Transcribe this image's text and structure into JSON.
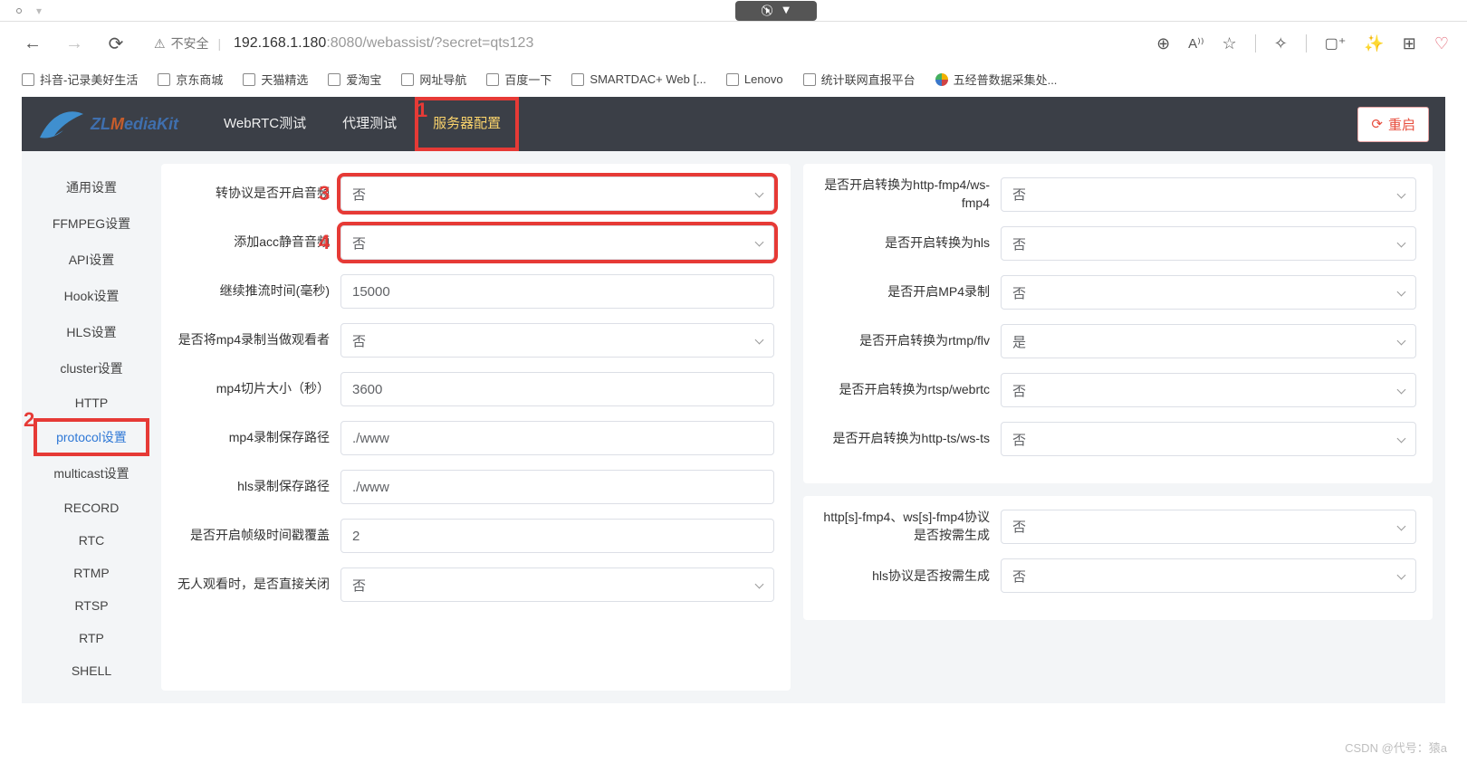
{
  "browser": {
    "url_host": "192.168.1.180",
    "url_port": ":8080",
    "url_path": "/webassist/?secret=qts123",
    "insecure_label": "不安全",
    "bookmarks": [
      "抖音-记录美好生活",
      "京东商城",
      "天猫精选",
      "爱淘宝",
      "网址导航",
      "百度一下",
      "SMARTDAC+ Web [...",
      "Lenovo",
      "统计联网直报平台",
      "五经普数据采集处..."
    ]
  },
  "logo_text": {
    "zl": "ZL",
    "m": "M",
    "rest": "ediaKit"
  },
  "nav": {
    "items": [
      "WebRTC测试",
      "代理测试",
      "服务器配置"
    ],
    "activeIndex": 2
  },
  "restart_label": "重启",
  "annotations": {
    "one": "1",
    "two": "2",
    "three": "3",
    "four": "4"
  },
  "watermark": "CSDN @代号：猿a",
  "sidebar": {
    "items": [
      "通用设置",
      "FFMPEG设置",
      "API设置",
      "Hook设置",
      "HLS设置",
      "cluster设置",
      "HTTP",
      "protocol设置",
      "multicast设置",
      "RECORD",
      "RTC",
      "RTMP",
      "RTSP",
      "RTP",
      "SHELL"
    ],
    "activeIndex": 7
  },
  "leftForm": {
    "rows": [
      {
        "label": "转协议是否开启音频",
        "value": "否",
        "type": "select",
        "highlight": true,
        "mark": "3"
      },
      {
        "label": "添加acc静音音频",
        "value": "否",
        "type": "select",
        "highlight": true,
        "mark": "4"
      },
      {
        "label": "继续推流时间(毫秒)",
        "value": "15000",
        "type": "input"
      },
      {
        "label": "是否将mp4录制当做观看者",
        "value": "否",
        "type": "select"
      },
      {
        "label": "mp4切片大小（秒）",
        "value": "3600",
        "type": "input"
      },
      {
        "label": "mp4录制保存路径",
        "value": "./www",
        "type": "input"
      },
      {
        "label": "hls录制保存路径",
        "value": "./www",
        "type": "input"
      },
      {
        "label": "是否开启帧级时间戳覆盖",
        "value": "2",
        "type": "input"
      },
      {
        "label": "无人观看时，是否直接关闭",
        "value": "否",
        "type": "select"
      }
    ]
  },
  "rightTopForm": {
    "rows": [
      {
        "label": "是否开启转换为http-fmp4/ws-fmp4",
        "value": "否"
      },
      {
        "label": "是否开启转换为hls",
        "value": "否"
      },
      {
        "label": "是否开启MP4录制",
        "value": "否"
      },
      {
        "label": "是否开启转换为rtmp/flv",
        "value": "是"
      },
      {
        "label": "是否开启转换为rtsp/webrtc",
        "value": "否"
      },
      {
        "label": "是否开启转换为http-ts/ws-ts",
        "value": "否"
      }
    ]
  },
  "rightBottomForm": {
    "rows": [
      {
        "label": "http[s]-fmp4、ws[s]-fmp4协议是否按需生成",
        "value": "否"
      },
      {
        "label": "hls协议是否按需生成",
        "value": "否"
      }
    ]
  }
}
